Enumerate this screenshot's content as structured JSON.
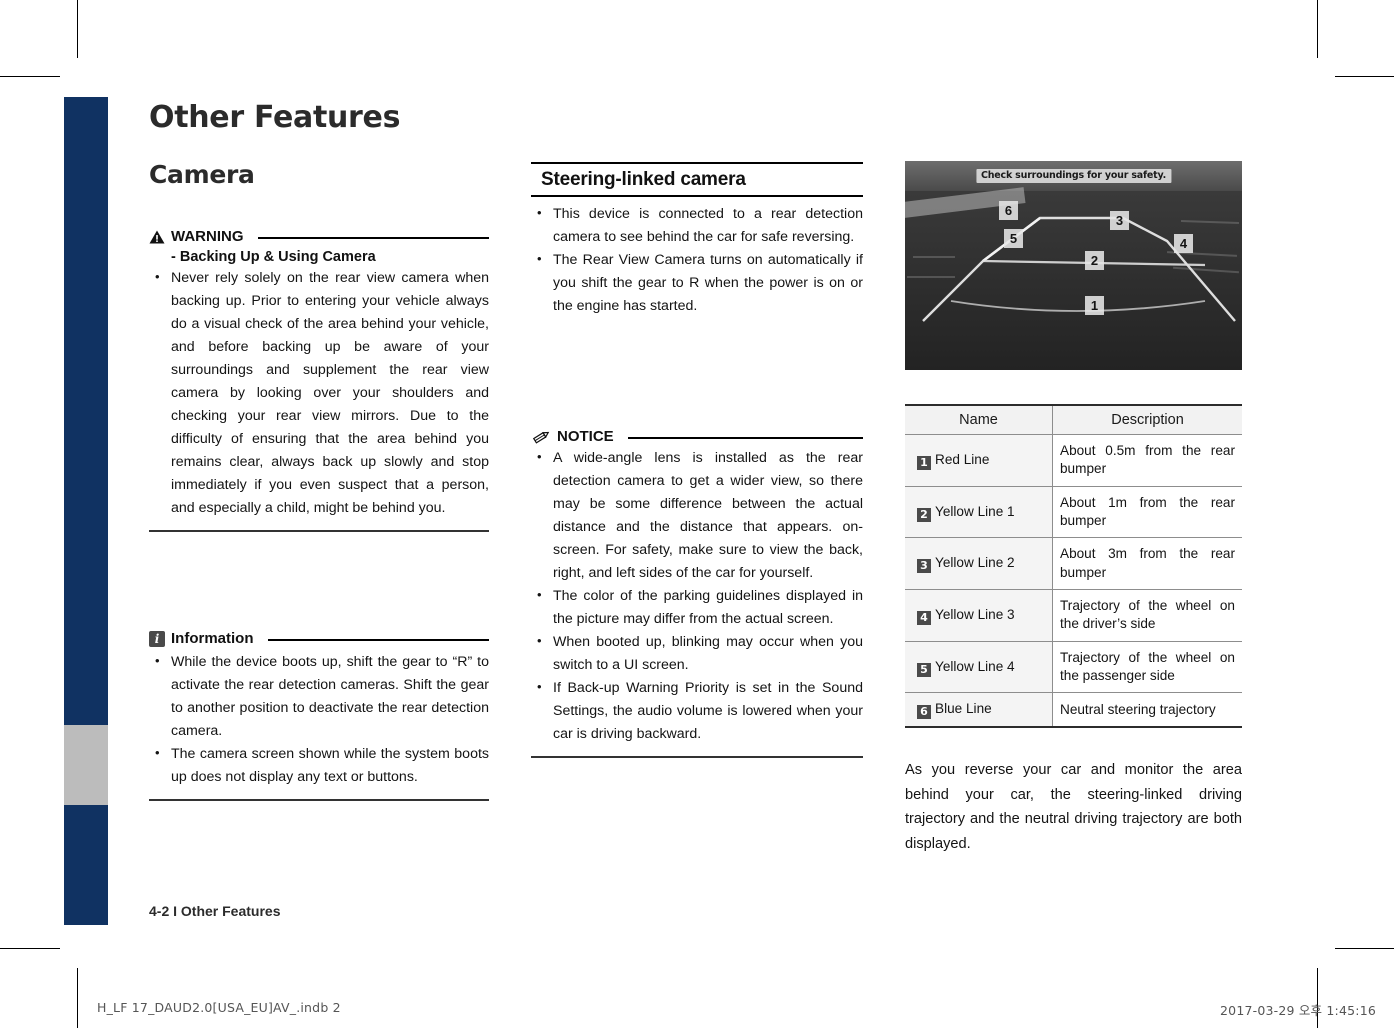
{
  "header": {
    "page_title": "Other Features",
    "section_title": "Camera"
  },
  "warning": {
    "icon": "warning-triangle-icon",
    "label": "WARNING",
    "subtitle": "- Backing Up & Using Camera",
    "items": [
      "Never rely solely on the rear view camera when backing up. Prior to entering your vehicle always do a visual check of the area behind your vehicle, and before backing up be aware of your surroundings and supplement the rear view camera by looking over your shoulders and checking your rear view mirrors. Due to the difficulty of ensuring that the area behind you remains clear, always back up slowly and stop immediately if you even suspect that a person, and especially a child, might be behind you."
    ]
  },
  "information": {
    "icon": "information-icon",
    "label": "Information",
    "items": [
      "While the device boots up, shift the gear to “R” to activate the rear detection cameras. Shift the gear to another position to deactivate the rear detection camera.",
      "The camera screen shown while the system boots up does not display any text or buttons."
    ]
  },
  "steering_linked": {
    "heading": "Steering-linked camera",
    "items": [
      "This device is connected to a rear detection camera to see behind the car for safe reversing.",
      "The Rear View Camera turns on automatically if you shift the gear to R when the power is on or the engine has started."
    ]
  },
  "notice": {
    "icon": "pencil-icon",
    "label": "NOTICE",
    "items": [
      "A wide-angle lens is installed as the rear detection camera to get a wider view, so there may be some difference between the actual distance and the distance that appears. on-screen. For safety, make sure to view the back, right, and left sides of the car for yourself.",
      "The color of the parking guidelines displayed in the picture may differ from the actual screen.",
      "When booted up, blinking may occur when you switch to a UI screen.",
      "If Back-up Warning Priority is set in the Sound Settings, the audio volume is lowered when your car is driving backward."
    ]
  },
  "camera_image": {
    "banner_text": "Check surroundings for your safety.",
    "callouts": [
      "1",
      "2",
      "3",
      "4",
      "5",
      "6"
    ]
  },
  "table": {
    "headers": [
      "Name",
      "Description"
    ],
    "rows": [
      {
        "num": "1",
        "name": "Red Line",
        "description": "About 0.5m from the rear bumper"
      },
      {
        "num": "2",
        "name": "Yellow Line 1",
        "description": "About 1m from the rear bumper"
      },
      {
        "num": "3",
        "name": "Yellow Line 2",
        "description": "About 3m from the rear bumper"
      },
      {
        "num": "4",
        "name": "Yellow Line 3",
        "description": "Trajectory of the wheel on the driver’s side"
      },
      {
        "num": "5",
        "name": "Yellow Line 4",
        "description": "Trajectory of the wheel on the passenger side"
      },
      {
        "num": "6",
        "name": "Blue Line",
        "description": "Neutral steering trajectory"
      }
    ]
  },
  "closing_paragraph": "As you reverse your car and monitor the area behind your car, the steering-linked driving trajectory and the neutral driving trajectory are both displayed.",
  "footer": {
    "folio": "4-2 I Other Features",
    "filename": "H_LF 17_DAUD2.0[USA_EU]AV_.indb   2",
    "timestamp": "2017-03-29   오후 1:45:16"
  },
  "colors": {
    "tab_blue": "#103262",
    "tab_active_gray": "#bcbcbc",
    "badge_gray": "#4a4a4a"
  }
}
